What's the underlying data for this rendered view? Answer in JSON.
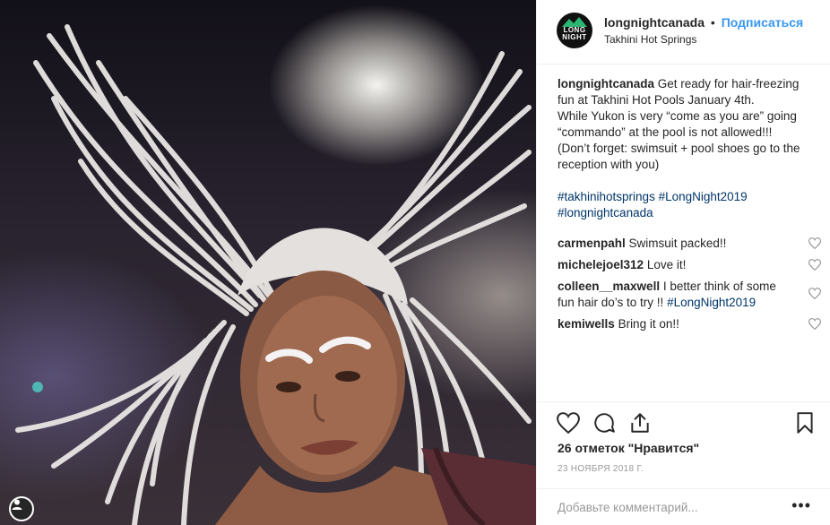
{
  "post": {
    "username": "longnightcanada",
    "separator": "•",
    "follow_label": "Подписаться",
    "location": "Takhini Hot Springs",
    "logo_text_1": "LONG",
    "logo_text_2": "NIGHT"
  },
  "caption": {
    "username": "longnightcanada",
    "lines": [
      "Get ready for hair-freezing",
      "fun at Takhini Hot Pools January 4th.",
      "While Yukon is very “come as you are” going",
      "“commando” at the pool is not allowed!!!",
      "(Don’t forget: swimsuit + pool shoes go to the",
      "reception with you)"
    ],
    "hashtags_line_1": "#takhinihotsprings #LongNight2019",
    "hashtags_line_2": "#longnightcanada"
  },
  "comments": [
    {
      "user": "carmenpahl",
      "text": "Swimsuit packed!!"
    },
    {
      "user": "michelejoel312",
      "text": "Love it!"
    },
    {
      "user": "colleen__maxwell",
      "text": "I better think of some",
      "text2": "fun hair do’s to try !! ",
      "tag": "#LongNight2019"
    },
    {
      "user": "kemiwells",
      "text": "Bring it on!!"
    }
  ],
  "likes_text": "26 отметок \"Нравится\"",
  "date_text": "23 НОЯБРЯ 2018 Г.",
  "add_comment_placeholder": "Добавьте комментарий...",
  "more_label": "•••",
  "icons": [
    "heart-icon",
    "comment-icon",
    "share-icon",
    "bookmark-icon",
    "user-icon"
  ],
  "colors": {
    "follow": "#3897f0",
    "hashtag": "#003569",
    "muted": "#999999",
    "text": "#262626"
  }
}
